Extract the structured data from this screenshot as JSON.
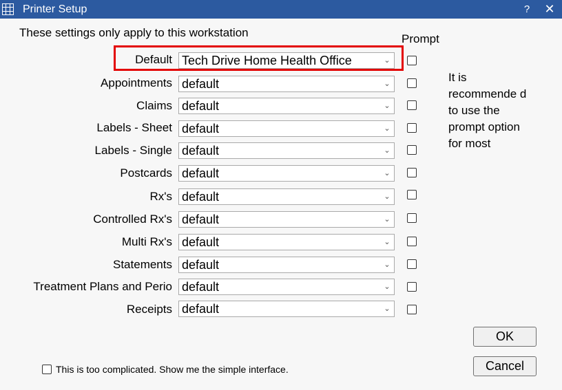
{
  "window": {
    "title": "Printer Setup",
    "help": "?",
    "close": "✕"
  },
  "header": "These settings only apply to this workstation",
  "prompt_header": "Prompt",
  "rows": [
    {
      "label": "Default",
      "value": "Tech Drive Home Health Office"
    },
    {
      "label": "Appointments",
      "value": "default"
    },
    {
      "label": "Claims",
      "value": "default"
    },
    {
      "label": "Labels - Sheet",
      "value": "default"
    },
    {
      "label": "Labels - Single",
      "value": "default"
    },
    {
      "label": "Postcards",
      "value": "default"
    },
    {
      "label": "Rx's",
      "value": "default"
    },
    {
      "label": "Controlled Rx's",
      "value": "default"
    },
    {
      "label": "Multi Rx's",
      "value": "default"
    },
    {
      "label": "Statements",
      "value": "default"
    },
    {
      "label": "Treatment Plans and Perio",
      "value": "default"
    },
    {
      "label": "Receipts",
      "value": "default"
    }
  ],
  "note": "It is recommende d to use the prompt option for most",
  "ok_label": "OK",
  "cancel_label": "Cancel",
  "simple_label": "This is too complicated.  Show me the simple interface.",
  "colors": {
    "titlebar": "#2c5aa0",
    "highlight": "#e30000"
  }
}
